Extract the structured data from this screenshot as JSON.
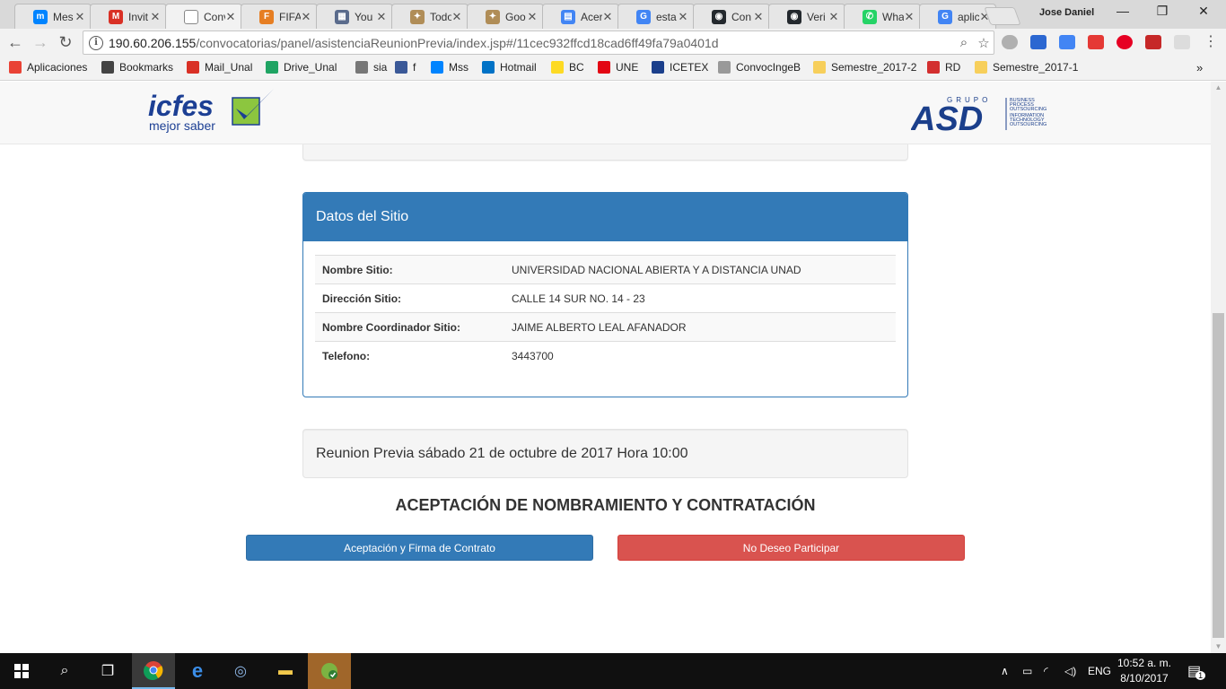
{
  "browser": {
    "tabs": [
      {
        "title": "Mes",
        "icon": "messenger-icon",
        "color": "#0084ff",
        "glyph": "m",
        "active": false
      },
      {
        "title": "Invit",
        "icon": "gmail-icon",
        "color": "#d93025",
        "glyph": "M",
        "active": false
      },
      {
        "title": "Conv",
        "icon": "page-icon",
        "color": "#ffffff",
        "glyph": "",
        "active": true
      },
      {
        "title": "FIFA",
        "icon": "fifa-icon",
        "color": "#e67e22",
        "glyph": "F",
        "active": false
      },
      {
        "title": "You",
        "icon": "windows-icon",
        "color": "#5a6b8c",
        "glyph": "▦",
        "active": false
      },
      {
        "title": "Todo",
        "icon": "crest-icon",
        "color": "#b08d57",
        "glyph": "✦",
        "active": false
      },
      {
        "title": "Goo",
        "icon": "crest-icon",
        "color": "#b08d57",
        "glyph": "✦",
        "active": false
      },
      {
        "title": "Acer",
        "icon": "docs-icon",
        "color": "#4285f4",
        "glyph": "▤",
        "active": false
      },
      {
        "title": "esta",
        "icon": "google-icon",
        "color": "#4285f4",
        "glyph": "G",
        "active": false
      },
      {
        "title": "Con",
        "icon": "github-icon",
        "color": "#24292e",
        "glyph": "◉",
        "active": false
      },
      {
        "title": "Veri",
        "icon": "github-icon",
        "color": "#24292e",
        "glyph": "◉",
        "active": false
      },
      {
        "title": "Wha",
        "icon": "whatsapp-icon",
        "color": "#25d366",
        "glyph": "✆",
        "active": false
      },
      {
        "title": "aplic",
        "icon": "google-icon",
        "color": "#4285f4",
        "glyph": "G",
        "active": false
      }
    ],
    "profile_name": "Jose Daniel",
    "url_host": "190.60.206.155",
    "url_path": "/convocatorias/panel/asistenciaReunionPrevia/index.jsp#/11cec932ffcd18cad6ff49fa79a0401d"
  },
  "bookmarks": [
    {
      "label": "Aplicaciones",
      "icon": "apps-grid-icon",
      "color": "#e94235"
    },
    {
      "label": "Bookmarks",
      "icon": "star-icon",
      "color": "#444444"
    },
    {
      "label": "Mail_Unal",
      "icon": "gmail-icon",
      "color": "#d93025"
    },
    {
      "label": "Drive_Unal",
      "icon": "drive-icon",
      "color": "#1fa463"
    },
    {
      "label": "sia",
      "icon": "page-icon",
      "color": "#777777"
    },
    {
      "label": "f",
      "icon": "facebook-icon",
      "color": "#3b5998"
    },
    {
      "label": "Mss",
      "icon": "messenger-icon",
      "color": "#0084ff"
    },
    {
      "label": "Hotmail",
      "icon": "outlook-icon",
      "color": "#0072c6"
    },
    {
      "label": "BC",
      "icon": "bancolombia-icon",
      "color": "#fdda24"
    },
    {
      "label": "UNE",
      "icon": "une-icon",
      "color": "#e30613"
    },
    {
      "label": "ICETEX",
      "icon": "icetex-icon",
      "color": "#1b3f8b"
    },
    {
      "label": "ConvocIngeB",
      "icon": "gear-icon",
      "color": "#999999"
    },
    {
      "label": "Semestre_2017-2",
      "icon": "folder-icon",
      "color": "#f7cf5b"
    },
    {
      "label": "RD",
      "icon": "rd-icon",
      "color": "#d32f2f"
    },
    {
      "label": "Semestre_2017-1",
      "icon": "folder-icon",
      "color": "#f7cf5b"
    }
  ],
  "header": {
    "logo_left_main": "icfes",
    "logo_left_sub": "mejor saber",
    "logo_right_top": "GRUPO",
    "logo_right_main": "ASD",
    "logo_right_lines": [
      "BUSINESS",
      "PROCESS",
      "OUTSOURCING",
      "INFORMATION",
      "TECHNOLOGY",
      "OUTSOURCING"
    ]
  },
  "site_panel": {
    "title": "Datos del Sitio",
    "rows": [
      {
        "label": "Nombre Sitio:",
        "value": "UNIVERSIDAD NACIONAL ABIERTA Y A DISTANCIA UNAD"
      },
      {
        "label": "Dirección Sitio:",
        "value": "CALLE 14 SUR NO. 14 - 23"
      },
      {
        "label": "Nombre Coordinador Sitio:",
        "value": "JAIME ALBERTO LEAL AFANADOR"
      },
      {
        "label": "Telefono:",
        "value": "3443700"
      }
    ]
  },
  "meeting_text": "Reunion Previa sábado 21 de octubre de 2017 Hora 10:00",
  "section_title": "ACEPTACIÓN DE NOMBRAMIENTO Y CONTRATACIÓN",
  "actions": {
    "accept_label": "Aceptación y Firma de Contrato",
    "decline_label": "No Deseo Participar"
  },
  "taskbar": {
    "language": "ENG",
    "time": "10:52 a. m.",
    "date": "8/10/2017",
    "notifications": "1"
  },
  "colors": {
    "primary": "#337ab7",
    "danger": "#d9534f",
    "icfes_blue": "#1c3f94",
    "icfes_green": "#8cc63f"
  }
}
